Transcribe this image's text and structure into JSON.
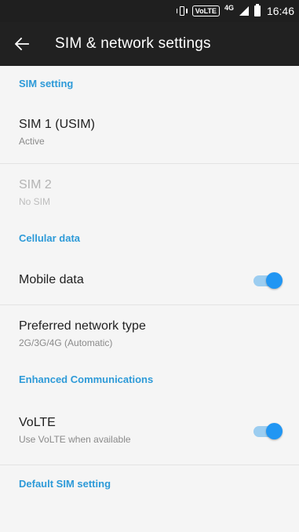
{
  "status_bar": {
    "volte_badge": "VoLTE",
    "network_badge": "4G",
    "time": "16:46"
  },
  "app_bar": {
    "title": "SIM & network settings",
    "back_icon": "arrow-back-icon"
  },
  "sections": {
    "sim_setting": {
      "header": "SIM setting"
    },
    "cellular_data": {
      "header": "Cellular data"
    },
    "enhanced_communications": {
      "header": "Enhanced Communications"
    },
    "default_sim_setting": {
      "header": "Default SIM setting"
    }
  },
  "items": {
    "sim1": {
      "title": "SIM 1  (USIM)",
      "subtitle": "Active"
    },
    "sim2": {
      "title": "SIM 2",
      "subtitle": "No SIM"
    },
    "mobile_data": {
      "title": "Mobile data",
      "toggle_on": true
    },
    "preferred_network": {
      "title": "Preferred network type",
      "subtitle": "2G/3G/4G (Automatic)"
    },
    "volte": {
      "title": "VoLTE",
      "subtitle": "Use VoLTE when available",
      "toggle_on": true
    }
  },
  "colors": {
    "accent": "#2d9ad8",
    "toggle_thumb": "#2196f3",
    "toggle_track": "#9ccdf0",
    "app_bar": "#212121"
  }
}
